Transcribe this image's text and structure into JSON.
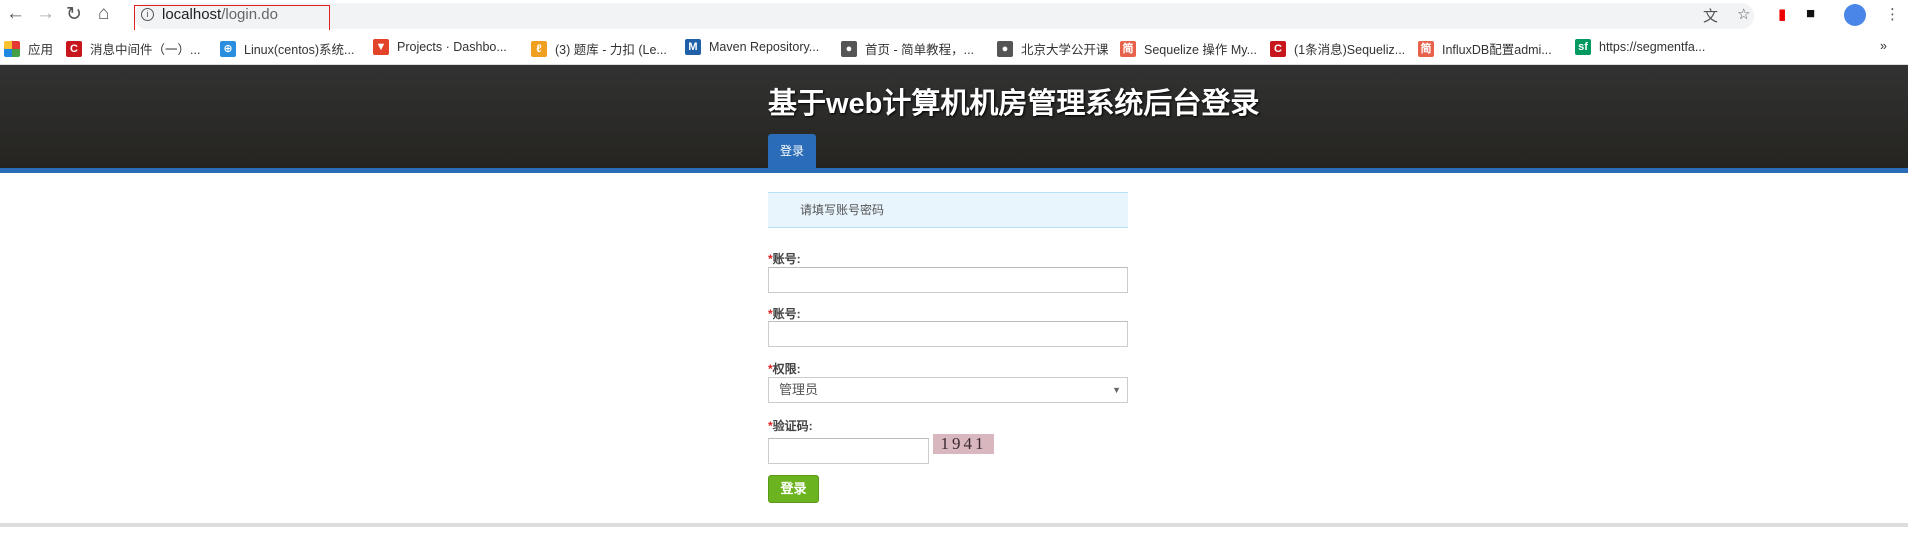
{
  "browser": {
    "url_host": "localhost",
    "url_path": "/login.do",
    "bookmarks": [
      {
        "label": "应用",
        "color": "#e8a33a"
      },
      {
        "label": "消息中间件（一）...",
        "color": "#c8161d",
        "glyph": "C"
      },
      {
        "label": "Linux(centos)系统...",
        "color": "#2a8ee0",
        "glyph": "⊕"
      },
      {
        "label": "Projects · Dashbo...",
        "color": "#e24329",
        "glyph": "▼"
      },
      {
        "label": "(3) 题库 - 力扣 (Le...",
        "color": "#f0a020",
        "glyph": "ℓ"
      },
      {
        "label": "Maven Repository...",
        "color": "#1f60a8",
        "glyph": "M"
      },
      {
        "label": "首页 - 简单教程，...",
        "color": "#555",
        "glyph": "●"
      },
      {
        "label": "北京大学公开课",
        "color": "#555",
        "glyph": "●"
      },
      {
        "label": "Sequelize 操作 My...",
        "color": "#e8614a",
        "glyph": "简"
      },
      {
        "label": "(1条消息)Sequeliz...",
        "color": "#c8161d",
        "glyph": "C"
      },
      {
        "label": "InfluxDB配置admi...",
        "color": "#e8614a",
        "glyph": "简"
      },
      {
        "label": "https://segmentfa...",
        "color": "#009a61",
        "glyph": "sf"
      }
    ],
    "more": "»"
  },
  "header": {
    "title": "基于web计算机机房管理系统后台登录",
    "tab": "登录"
  },
  "form": {
    "notice": "请填写账号密码",
    "required_mark": "*",
    "account_label": "账号:",
    "password_label": "账号:",
    "role_label": "权限:",
    "role_value": "管理员",
    "captcha_label": "验证码:",
    "captcha_text": "1941",
    "submit": "登录"
  }
}
